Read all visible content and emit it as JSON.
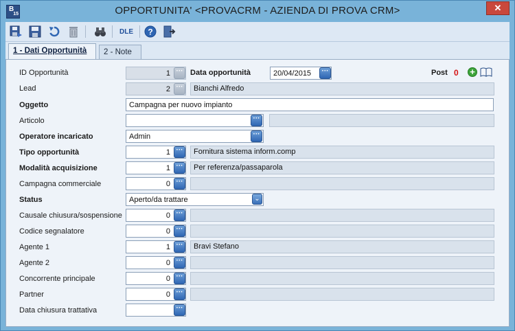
{
  "window": {
    "title": "OPPORTUNITA' <PROVACRM - AZIENDA DI PROVA CRM>",
    "icon_letter": "B",
    "icon_number": "15",
    "close_glyph": "✕"
  },
  "toolbar": {
    "icons": [
      "save-and-close-icon",
      "save-icon",
      "undo-icon",
      "delete-icon",
      "search-binoculars-icon",
      "dle-icon",
      "help-icon",
      "exit-icon"
    ],
    "dle_label": "DLE"
  },
  "tabs": [
    {
      "label": "1 - Dati Opportunità",
      "active": true
    },
    {
      "label": "2 - Note",
      "active": false
    }
  ],
  "form": {
    "id_opportunita": {
      "label": "ID Opportunità",
      "value": "1"
    },
    "data_opportunita": {
      "label": "Data opportunità",
      "value": "20/04/2015"
    },
    "post": {
      "label": "Post",
      "count": "0"
    },
    "lead": {
      "label": "Lead",
      "value": "2",
      "description": "Bianchi Alfredo"
    },
    "oggetto": {
      "label": "Oggetto",
      "value": "Campagna per nuovo impianto"
    },
    "articolo": {
      "label": "Articolo",
      "value": "",
      "description": ""
    },
    "operatore": {
      "label": "Operatore incaricato",
      "value": "Admin"
    },
    "tipo_opportunita": {
      "label": "Tipo opportunità",
      "value": "1",
      "description": "Fornitura sistema inform.comp"
    },
    "modalita_acquisizione": {
      "label": "Modalità acquisizione",
      "value": "1",
      "description": "Per referenza/passaparola"
    },
    "campagna": {
      "label": "Campagna commerciale",
      "value": "0",
      "description": ""
    },
    "status": {
      "label": "Status",
      "value": "Aperto/da trattare"
    },
    "causale": {
      "label": "Causale chiusura/sospensione",
      "value": "0",
      "description": ""
    },
    "segnalatore": {
      "label": "Codice segnalatore",
      "value": "0",
      "description": ""
    },
    "agente1": {
      "label": "Agente 1",
      "value": "1",
      "description": "Bravi Stefano"
    },
    "agente2": {
      "label": "Agente 2",
      "value": "0",
      "description": ""
    },
    "concorrente": {
      "label": "Concorrente principale",
      "value": "0",
      "description": ""
    },
    "partner": {
      "label": "Partner",
      "value": "0",
      "description": ""
    },
    "data_chiusura": {
      "label": "Data chiusura trattativa",
      "value": ""
    }
  },
  "glyphs": {
    "dots": "···",
    "chevron": "⌄",
    "plus": "+"
  },
  "colors": {
    "titlebar": "#79b3d9",
    "close": "#c9483c",
    "post_count": "#d41414",
    "lookup_button": "#3f74bd"
  }
}
